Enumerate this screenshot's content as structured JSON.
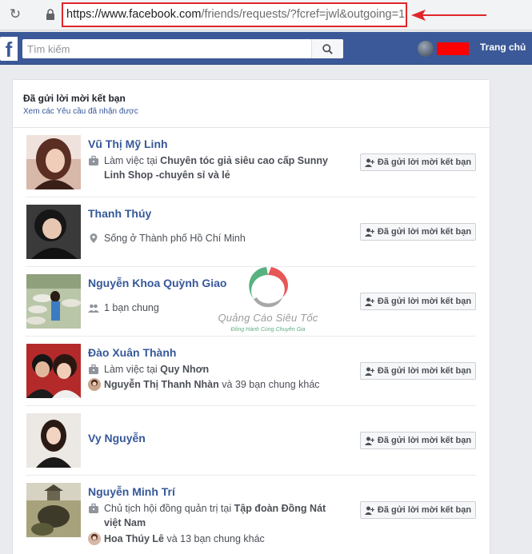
{
  "browser": {
    "url_main": "https://www.facebook.com",
    "url_rest": "/friends/requests/?fcref=jwl&outgoing=1",
    "reload_icon": "reload-icon",
    "lock_icon": "lock-icon"
  },
  "header": {
    "search_placeholder": "Tìm kiếm",
    "home_label": "Trang chủ",
    "brand_color": "#3b5998"
  },
  "card": {
    "title": "Đã gửi lời mời kết bạn",
    "subtitle_link": "Xem các Yêu cầu đã nhận được"
  },
  "requests": [
    {
      "name": "Vũ Thị Mỹ Linh",
      "line1_icon": "briefcase-icon",
      "line1_prefix": "Làm việc tại ",
      "line1_bold": "Chuyên tóc giả siêu cao cấp Sunny Linh Shop -chuyên sỉ và lẻ",
      "button": "Đã gửi lời mời kết bạn"
    },
    {
      "name": "Thanh Thúy",
      "line1_icon": "location-pin-icon",
      "line1_prefix": "Sống ở Thành phố Hồ Chí Minh",
      "button": "Đã gửi lời mời kết bạn"
    },
    {
      "name": "Nguyễn Khoa Quỳnh Giao",
      "line1_icon": "mutual-friends-icon",
      "line1_prefix": "1 bạn chung",
      "button": "Đã gửi lời mời kết bạn"
    },
    {
      "name": "Đào Xuân Thành",
      "line1_icon": "briefcase-icon",
      "line1_prefix": "Làm việc tại ",
      "line1_bold": "Quy Nhơn",
      "line2_bold": "Nguyễn Thị Thanh Nhàn",
      "line2_rest": " và 39 bạn chung khác",
      "button": "Đã gửi lời mời kết bạn"
    },
    {
      "name": "Vy Nguyễn",
      "button": "Đã gửi lời mời kết bạn"
    },
    {
      "name": "Nguyễn Minh Trí",
      "line1_icon": "briefcase-icon",
      "line1_prefix": "Chủ tịch hội đồng quản trị tại ",
      "line1_bold": "Tập đoàn Đồng Nát việt Nam",
      "line2_bold": "Hoa Thúy Lê",
      "line2_rest": " và 13 bạn chung khác",
      "button": "Đã gửi lời mời kết bạn"
    }
  ],
  "watermark": {
    "title": "Quảng Cáo Siêu Tốc",
    "subtitle": "Đồng Hành Cùng Chuyên Gia"
  }
}
